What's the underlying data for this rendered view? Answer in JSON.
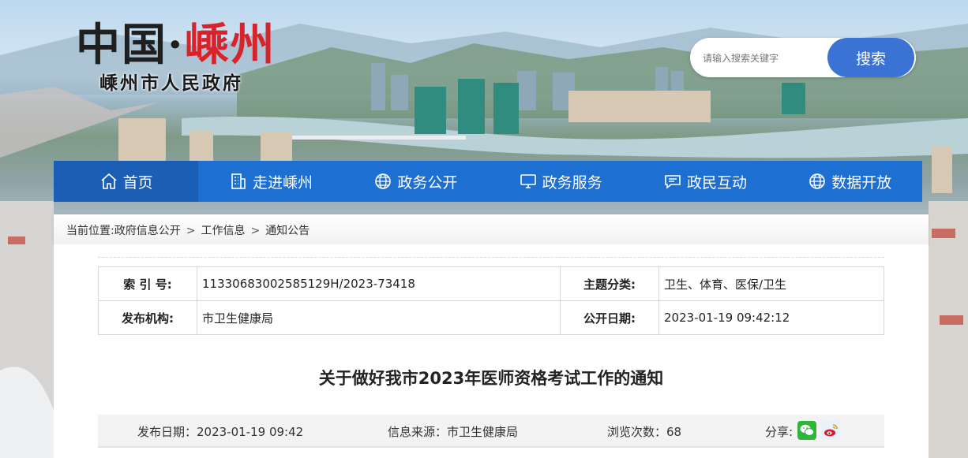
{
  "logo": {
    "part1": "中国",
    "dot": "·",
    "part2": "嵊州",
    "subtitle": "嵊州市人民政府"
  },
  "search": {
    "placeholder": "请输入搜索关键字",
    "button": "搜索"
  },
  "nav": [
    {
      "label": "首页",
      "icon": "home-icon"
    },
    {
      "label": "走进嵊州",
      "icon": "building-icon"
    },
    {
      "label": "政务公开",
      "icon": "globe-icon"
    },
    {
      "label": "政务服务",
      "icon": "monitor-icon"
    },
    {
      "label": "政民互动",
      "icon": "chat-icon"
    },
    {
      "label": "数据开放",
      "icon": "globe-icon"
    }
  ],
  "breadcrumb": {
    "prefix": "当前位置:",
    "items": [
      "政府信息公开",
      "工作信息",
      "通知公告"
    ],
    "separator": ">"
  },
  "meta": {
    "index_label": "索 引 号:",
    "index_value": "11330683002585129H/2023-73418",
    "topic_label": "主题分类:",
    "topic_value": "卫生、体育、医保/卫生",
    "org_label": "发布机构:",
    "org_value": "市卫生健康局",
    "open_label": "公开日期:",
    "open_value": "2023-01-19 09:42:12"
  },
  "article": {
    "title": "关于做好我市2023年医师资格考试工作的通知",
    "publish_date": "发布日期：2023-01-19 09:42",
    "source": "信息来源：市卫生健康局",
    "views": "浏览次数：68",
    "share_label": "分享:"
  },
  "colors": {
    "nav": "#1d6fd2",
    "nav_active": "#1a5eb6",
    "search_button": "#3a73d4",
    "logo_red": "#d8232a"
  }
}
